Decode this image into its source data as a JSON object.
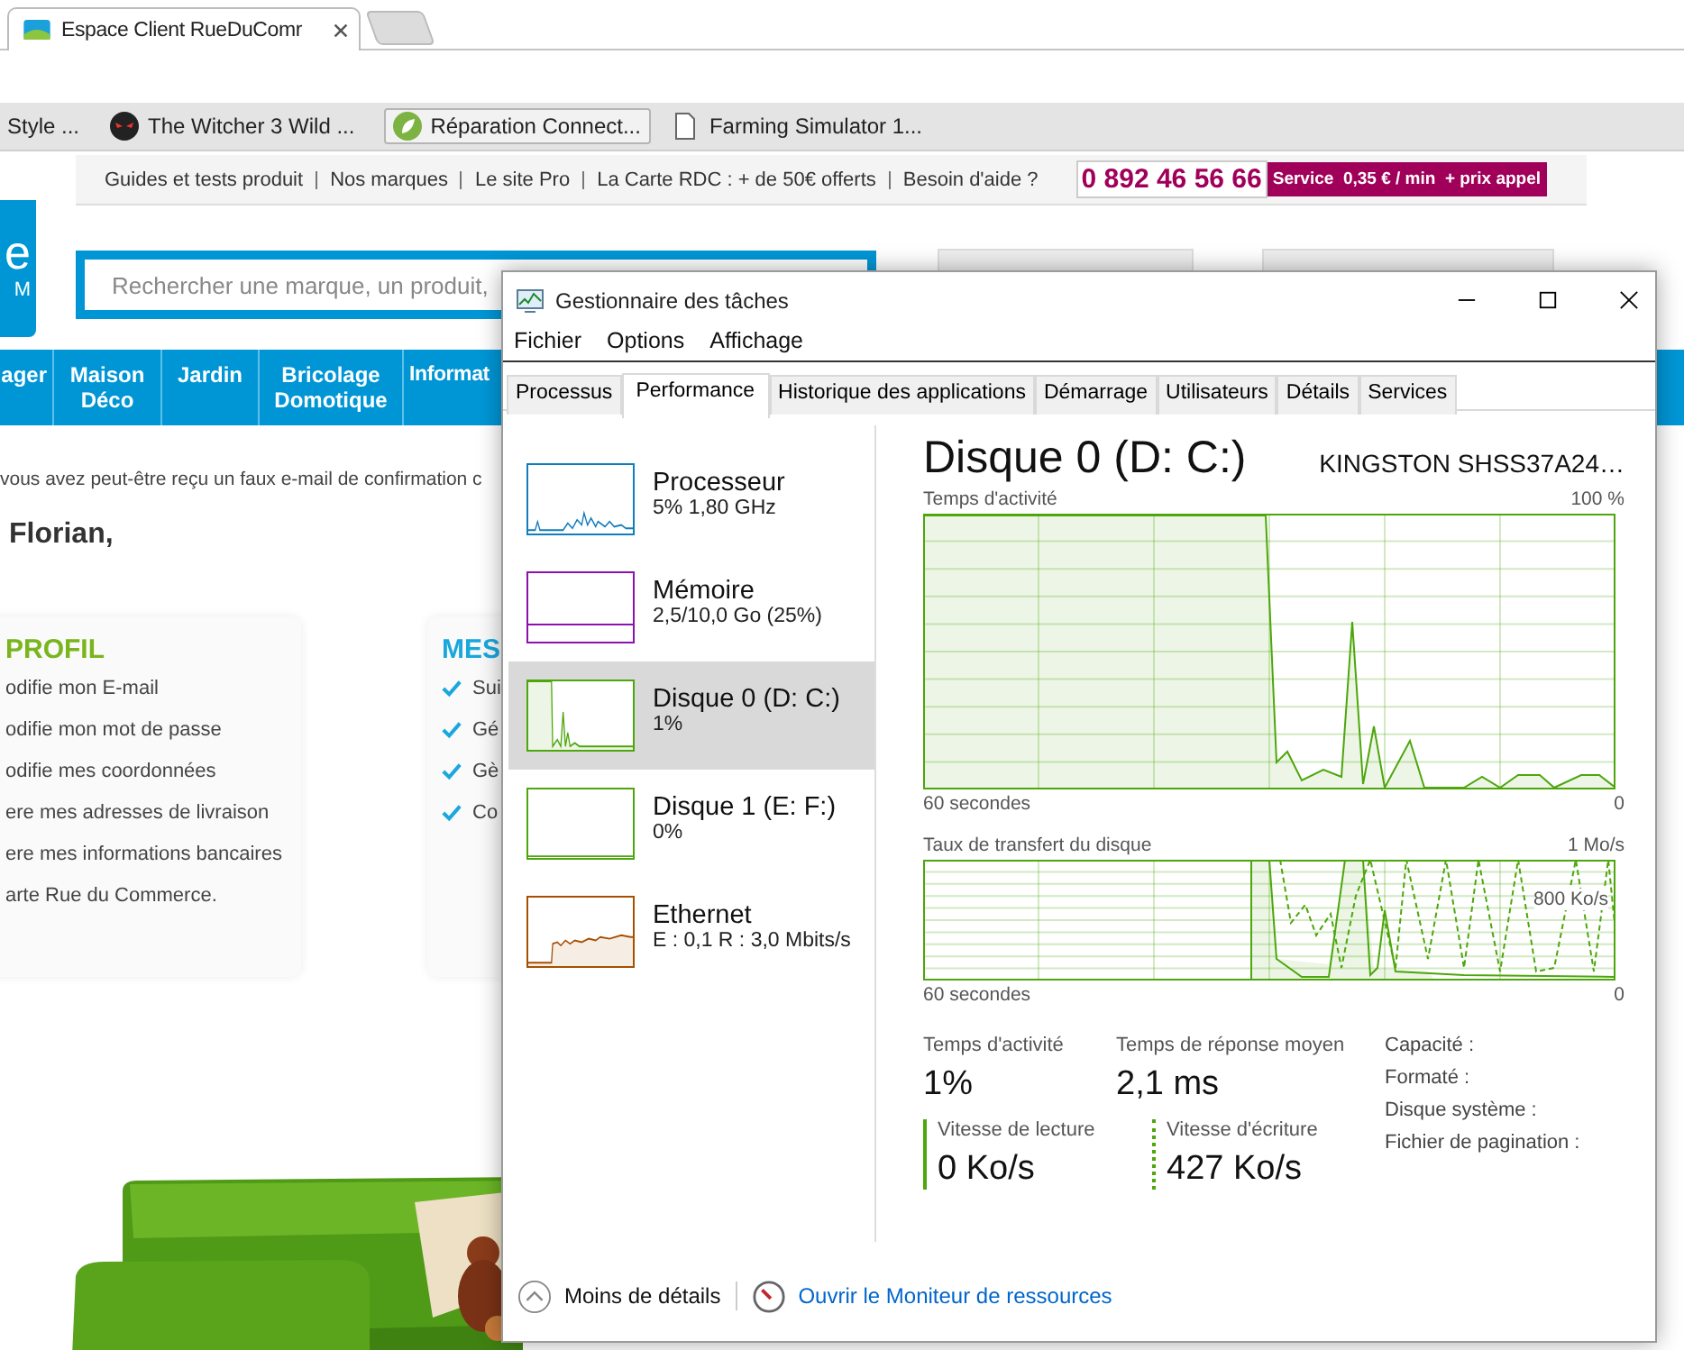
{
  "browser": {
    "tab": {
      "title": "Espace Client RueDuComr"
    },
    "bookmarks": [
      {
        "label": "Style ...",
        "selected": false
      },
      {
        "label": "The Witcher 3 Wild ...",
        "selected": false
      },
      {
        "label": "Réparation Connect...",
        "selected": true
      },
      {
        "label": "Farming Simulator 1...",
        "selected": false
      }
    ]
  },
  "site": {
    "top_links": [
      "Guides et tests produit",
      "Nos marques",
      "Le site Pro",
      "La Carte RDC : + de 50€ offerts",
      "Besoin d'aide ?"
    ],
    "phone": "0 892 46 56 66",
    "phone_rate": "Service  0,35 € / min  + prix appel",
    "logo": [
      "e",
      "M"
    ],
    "search": {
      "placeholder": "Rechercher une marque, un produit,"
    },
    "nav": [
      [
        "ager"
      ],
      [
        "Maison",
        "Déco"
      ],
      [
        "Jardin"
      ],
      [
        "Bricolage",
        "Domotique"
      ],
      [
        "Informat"
      ]
    ],
    "notice": "vous avez peut-être reçu un faux e-mail de confirmation c",
    "greeting": "Florian,",
    "profile_card": {
      "title": "PROFIL",
      "items": [
        "odifie mon E-mail",
        "odifie mon mot de passe",
        "odifie mes coordonnées",
        "ere mes adresses de livraison",
        "ere mes informations bancaires",
        "arte Rue du Commerce."
      ]
    },
    "services_card": {
      "title": "MES",
      "items": [
        "Sui",
        "Gé",
        "Gè",
        "Co"
      ]
    }
  },
  "task_manager": {
    "title": "Gestionnaire des tâches",
    "menu": [
      "Fichier",
      "Options",
      "Affichage"
    ],
    "tabs": [
      {
        "label": "Processus",
        "selected": false
      },
      {
        "label": "Performance",
        "selected": true
      },
      {
        "label": "Historique des applications",
        "selected": false
      },
      {
        "label": "Démarrage",
        "selected": false
      },
      {
        "label": "Utilisateurs",
        "selected": false
      },
      {
        "label": "Détails",
        "selected": false
      },
      {
        "label": "Services",
        "selected": false
      }
    ],
    "resources": [
      {
        "kind": "cpu",
        "name": "Processeur",
        "detail": "5% 1,80 GHz",
        "color": "#117dbb",
        "selected": false
      },
      {
        "kind": "memory",
        "name": "Mémoire",
        "detail": "2,5/10,0 Go (25%)",
        "color": "#8b12ae",
        "selected": false
      },
      {
        "kind": "disk_busy",
        "name": "Disque 0 (D: C:)",
        "detail": "1%",
        "color": "#4da60c",
        "selected": true
      },
      {
        "kind": "disk_idle",
        "name": "Disque 1 (E: F:)",
        "detail": "0%",
        "color": "#4da60c",
        "selected": false
      },
      {
        "kind": "network",
        "name": "Ethernet",
        "detail": "E : 0,1 R : 3,0 Mbits/s",
        "color": "#a74f01",
        "selected": false
      }
    ],
    "detail": {
      "title": "Disque 0 (D: C:)",
      "model": "KINGSTON SHSS37A24…",
      "activity_graph": {
        "label": "Temps d'activité",
        "max": "100 %",
        "span": "60 secondes",
        "min": "0"
      },
      "transfer_graph": {
        "label": "Taux de transfert du disque",
        "max": "1 Mo/s",
        "mark": "800 Ko/s",
        "span": "60 secondes",
        "min": "0"
      },
      "stats": [
        {
          "label": "Temps d'activité",
          "value": "1%"
        },
        {
          "label": "Temps de réponse moyen",
          "value": "2,1 ms"
        }
      ],
      "speeds": [
        {
          "kind": "solid",
          "label": "Vitesse de lecture",
          "value": "0 Ko/s"
        },
        {
          "kind": "dotted",
          "label": "Vitesse d'écriture",
          "value": "427 Ko/s"
        }
      ],
      "properties": [
        "Capacité :",
        "Formaté :",
        "Disque système :",
        "Fichier de pagination :"
      ]
    },
    "footer": {
      "less": "Moins de détails",
      "link": "Ouvrir le Moniteur de ressources"
    }
  }
}
